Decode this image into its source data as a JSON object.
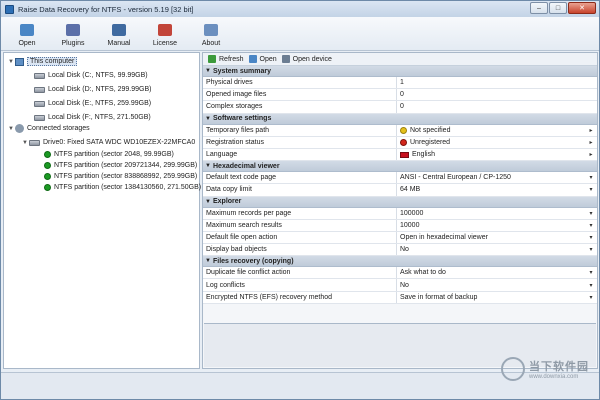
{
  "window": {
    "title": "Raise Data Recovery for NTFS - version 5.19 [32 bit]",
    "minimize": "–",
    "maximize": "□",
    "close": "✕"
  },
  "toolbar": {
    "items": [
      {
        "label": "Open",
        "color": "#4a86c5"
      },
      {
        "label": "Plugins",
        "color": "#5b6fa8"
      },
      {
        "label": "Manual",
        "color": "#3f6aa0"
      },
      {
        "label": "License",
        "color": "#c2453a"
      },
      {
        "label": "About",
        "color": "#6b8fbf"
      }
    ]
  },
  "tree": {
    "this_computer": "This computer",
    "disks": [
      "Local Disk (C:, NTFS, 99.99GB)",
      "Local Disk (D:, NTFS, 299.99GB)",
      "Local Disk (E:, NTFS, 259.99GB)",
      "Local Disk (F:, NTFS, 271.50GB)"
    ],
    "connected_storages": "Connected storages",
    "drive": "Drive0: Fixed SATA WDC WD10EZEX-22MFCA0",
    "partitions": [
      "NTFS partition (sector 2048, 99.99GB)",
      "NTFS partition (sector 209721344, 299.99GB)",
      "NTFS partition (sector 838868992, 259.99GB)",
      "NTFS partition (sector 1384130560, 271.50GB)"
    ]
  },
  "right_toolbar": {
    "refresh": "Refresh",
    "open": "Open",
    "open_device": "Open device"
  },
  "properties": {
    "system_summary": {
      "header": "System summary",
      "rows": [
        {
          "name": "Physical drives",
          "value": "1"
        },
        {
          "name": "Opened image files",
          "value": "0"
        },
        {
          "name": "Complex storages",
          "value": "0"
        }
      ]
    },
    "software_settings": {
      "header": "Software settings",
      "rows": [
        {
          "name": "Temporary files path",
          "value": "Not specified"
        },
        {
          "name": "Registration status",
          "value": "Unregistered"
        },
        {
          "name": "Language",
          "value": "English"
        }
      ]
    },
    "hex_viewer": {
      "header": "Hexadecimal viewer",
      "rows": [
        {
          "name": "Default text code page",
          "value": "ANSI - Central European / CP-1250"
        },
        {
          "name": "Data copy limit",
          "value": "64 MB"
        }
      ]
    },
    "explorer": {
      "header": "Explorer",
      "rows": [
        {
          "name": "Maximum records per page",
          "value": "100000"
        },
        {
          "name": "Maximum search results",
          "value": "10000"
        },
        {
          "name": "Default file open action",
          "value": "Open in hexadecimal viewer"
        },
        {
          "name": "Display bad objects",
          "value": "No"
        }
      ]
    },
    "files_recovery": {
      "header": "Files recovery (copying)",
      "rows": [
        {
          "name": "Duplicate file conflict action",
          "value": "Ask what to do"
        },
        {
          "name": "Log conflicts",
          "value": "No"
        },
        {
          "name": "Encrypted NTFS (EFS) recovery method",
          "value": "Save in format of backup"
        }
      ]
    }
  },
  "watermark": {
    "cn": "当下软件园",
    "url": "www.downxia.com"
  }
}
